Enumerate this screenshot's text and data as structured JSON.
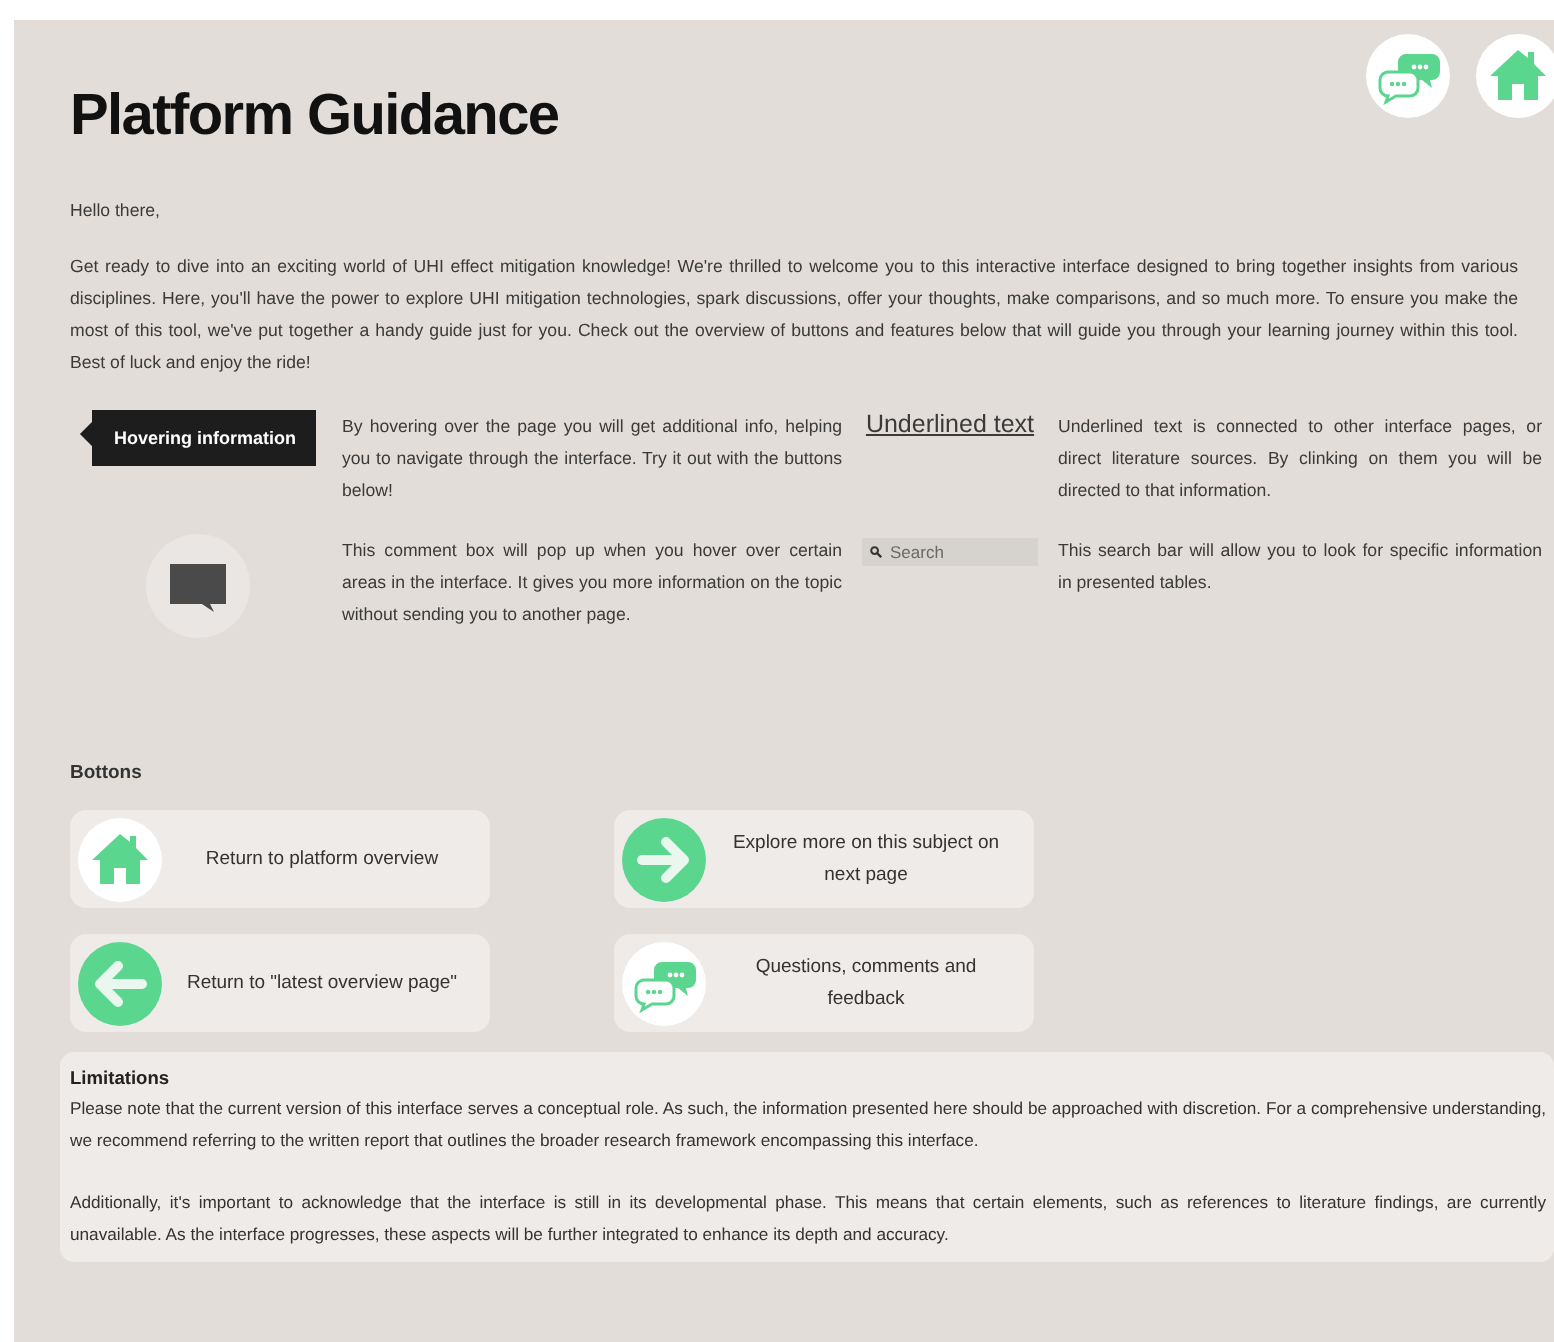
{
  "title": "Platform Guidance",
  "header_icons": [
    {
      "kind": "chat"
    },
    {
      "kind": "home"
    }
  ],
  "greeting": "Hello there,",
  "intro": "Get ready to dive into an exciting world of UHI effect mitigation knowledge! We're thrilled to welcome you to this interactive interface designed to bring together insights from various disciplines. Here, you'll have the power to explore UHI mitigation technologies, spark discussions, offer your thoughts, make comparisons, and so much more. To ensure you make the most of this tool, we've put together a handy guide just for you. Check out the overview of buttons and features below that will guide you through your learning journey within this tool. Best of luck and enjoy the ride!",
  "features": [
    {
      "kind": "tooltip",
      "sample": "Hovering information",
      "description": "By hovering over the page you will get additional info, helping you to navigate through the interface. Try it out with the buttons below!"
    },
    {
      "kind": "link",
      "sample": "Underlined text",
      "description": "Underlined text is connected to other interface pages, or direct literature sources. By clinking on them you will be directed to that information."
    },
    {
      "kind": "comment",
      "description": "This comment box will pop up when you hover over certain areas in the interface. It gives you more information on the topic without sending you to another page."
    },
    {
      "kind": "search",
      "placeholder": "Search",
      "description": "This search bar will allow you to look for specific information in presented tables."
    }
  ],
  "buttons_heading": "Bottons",
  "buttons": [
    {
      "kind": "home",
      "label": "Return to platform overview"
    },
    {
      "kind": "next",
      "label": "Explore more on this subject on next page"
    },
    {
      "kind": "back",
      "label": "Return to \"latest overview page\""
    },
    {
      "kind": "chat",
      "label": "Questions, comments and feedback"
    }
  ],
  "limitations": {
    "heading": "Limitations",
    "paragraphs": [
      "Please note that the current version of this interface serves a conceptual role. As such, the information presented here should be approached with discretion. For a comprehensive understanding, we recommend referring to the written report that outlines the broader research framework encompassing this interface.",
      "Additionally, it's important to acknowledge that the interface is still in its developmental phase. This means that certain elements, such as references to literature findings, are currently unavailable. As the interface progresses, these aspects will be further integrated to enhance its depth and accuracy."
    ]
  }
}
